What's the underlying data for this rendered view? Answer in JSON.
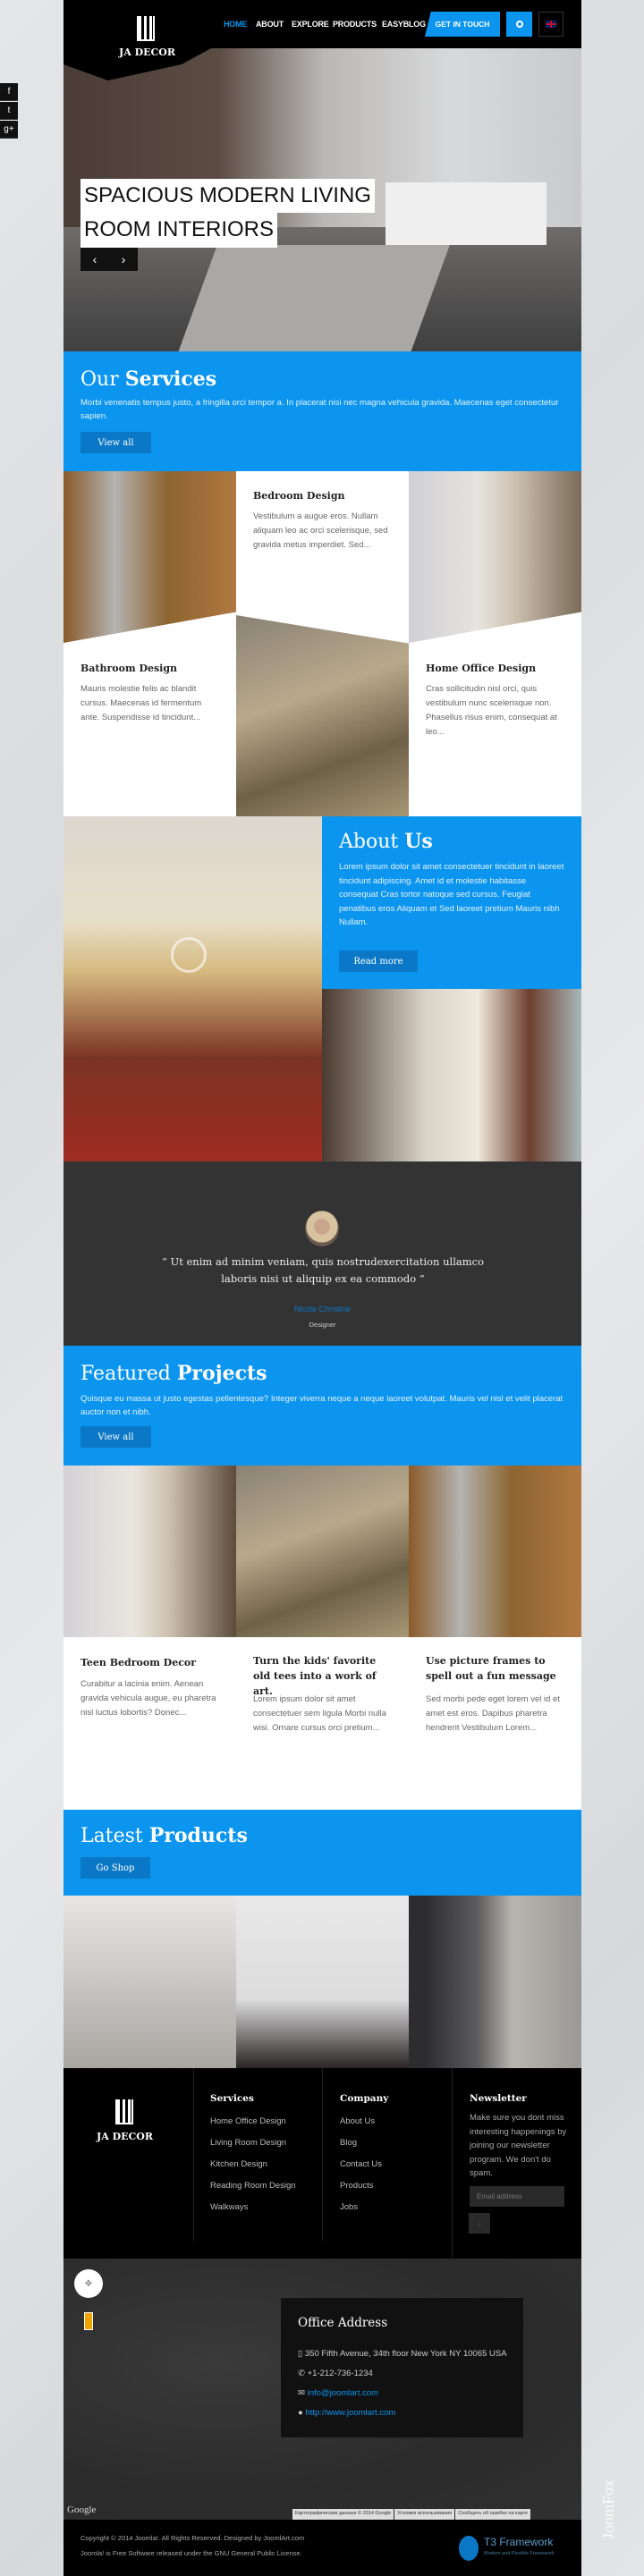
{
  "header": {
    "logo_text": "JA DECOR",
    "nav": [
      "HOME",
      "ABOUT",
      "EXPLORE",
      "PRODUCTS",
      "EASYBLOG"
    ],
    "cta": "GET IN TOUCH",
    "active": "HOME",
    "accent": "#0b95ef"
  },
  "social": [
    "f",
    "t",
    "g+"
  ],
  "hero": {
    "line1": "SPACIOUS MODERN LIVING",
    "line2": "ROOM INTERIORS",
    "prev": "‹",
    "next": "›"
  },
  "services": {
    "title_light": "Our",
    "title_bold": "Services",
    "desc": "Morbi venenatis tempus justo, a fringilla orci tempor a. In placerat nisi nec magna vehicula gravida. Maecenas eget consectetur sapien.",
    "button": "View all",
    "items": [
      {
        "title": "Bedroom Design",
        "text": "Vestibulum a augue eros. Nullam aliquam leo ac orci scelerisque, sed gravida metus imperdiet. Sed..."
      },
      {
        "title": "Bathroom Design",
        "text": "Mauris molestie felis ac blandit cursus. Maecenas id fermentum ante. Suspendisse id tincidunt..."
      },
      {
        "title": "Home Office Design",
        "text": "Cras sollicitudin nisl orci, quis vestibulum nunc scelerisque non. Phasellus risus enim, consequat at leo..."
      }
    ]
  },
  "about": {
    "title_light": "About",
    "title_bold": "Us",
    "desc": "Lorem ipsum dolor sit amet consectetuer tincidunt in laoreet tincidunt adipiscing. Amet id et molestie habitasse consequat Cras tortor natoque sed cursus. Feugiat penatibus eros Aliquam et Sed laoreet pretium Mauris nibh Nullam.",
    "button": "Read more"
  },
  "testimonial": {
    "quote": "“ Ut enim ad minim veniam, quis nostrudexercitation ullamco laboris nisi ut aliquip ex ea commodo ”",
    "name": "Nicole Christine",
    "role": "Designer"
  },
  "projects": {
    "title_light": "Featured",
    "title_bold": "Projects",
    "desc": "Quisque eu massa ut justo egestas pellentesque? Integer viverra neque a neque laoreet volutpat. Mauris vel nisl et velit placerat auctor non et nibh.",
    "button": "View all",
    "items": [
      {
        "title": "Teen Bedroom Decor",
        "text": "Curabitur a lacinia enim. Aenean gravida vehicula augue, eu pharetra nisl luctus lobortis? Donec..."
      },
      {
        "title": "Turn the kids' favorite old tees into a work of art.",
        "text": "Lorem ipsum dolor sit amet consectetuer sem ligula Morbi nulla wisi. Ornare cursus orci pretium..."
      },
      {
        "title": "Use picture frames to spell out a fun message",
        "text": "Sed morbi pede eget lorem vel id et amet est eros. Dapibus pharetra hendrerit Vestibulum Lorem..."
      }
    ]
  },
  "products": {
    "title_light": "Latest",
    "title_bold": "Products",
    "button": "Go Shop"
  },
  "footer": {
    "logo_text": "JA DECOR",
    "services": {
      "title": "Services",
      "links": [
        "Home Office Design",
        "Living Room Design",
        "Kitchen Design",
        "Reading Room Design",
        "Walkways"
      ]
    },
    "company": {
      "title": "Company",
      "links": [
        "About Us",
        "Blog",
        "Contact Us",
        "Products",
        "Jobs"
      ]
    },
    "newsletter": {
      "title": "Newsletter",
      "text": "Make sure you dont miss interesting happenings by joining our newsletter program. We don't do spam.",
      "placeholder": "Email address",
      "submit": "›"
    }
  },
  "map": {
    "google": "Google",
    "attribution": [
      "Картографические данные © 2014 Google",
      "Условия использования",
      "Сообщить об ошибке на карте"
    ],
    "office": {
      "title": "Office Address",
      "address": "350 Fifth Avenue, 34th floor New York NY 10065 USA",
      "phone": "+1-212-736-1234",
      "email": "info@joomlart.com",
      "web": "http://www.joomlart.com"
    }
  },
  "bottom": {
    "copyright": "Copyright © 2014 Joomla!. All Rights Reserved. Designed by JoomlArt.com",
    "license": "Joomla! is Free Software released under the GNU General Public License.",
    "t3": "T3 Framework",
    "t3_sub": "Modern and Flexible Framework",
    "watermark": "JoomFox"
  }
}
